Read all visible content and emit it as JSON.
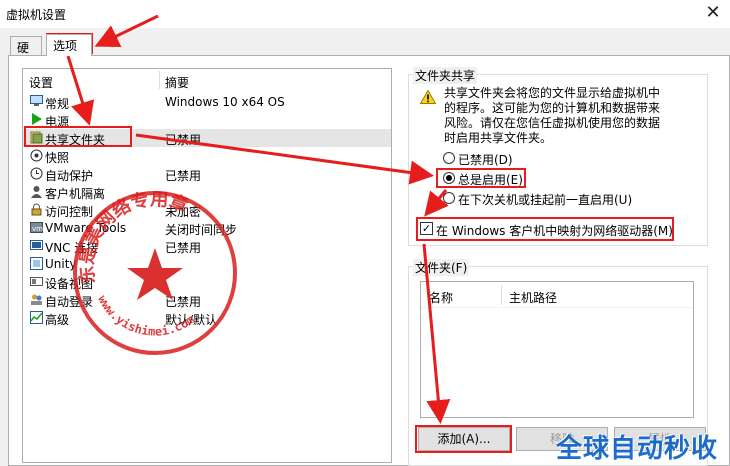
{
  "window": {
    "title": "虚拟机设置"
  },
  "tabs": [
    {
      "label": "硬件"
    },
    {
      "label": "选项"
    }
  ],
  "settings_list": {
    "headers": {
      "setting": "设置",
      "summary": "摘要"
    },
    "rows": [
      {
        "name": "常规",
        "summary": "Windows 10 x64 OS",
        "icon": "monitor-icon"
      },
      {
        "name": "电源",
        "summary": "",
        "icon": "play-icon"
      },
      {
        "name": "共享文件夹",
        "summary": "已禁用",
        "icon": "shared-folder-icon"
      },
      {
        "name": "快照",
        "summary": "",
        "icon": "snapshot-icon"
      },
      {
        "name": "自动保护",
        "summary": "已禁用",
        "icon": "clock-icon"
      },
      {
        "name": "客户机隔离",
        "summary": "",
        "icon": "user-icon"
      },
      {
        "name": "访问控制",
        "summary": "未加密",
        "icon": "lock-icon"
      },
      {
        "name": "VMware Tools",
        "summary": "关闭时间同步",
        "icon": "vm-icon"
      },
      {
        "name": "VNC 连接",
        "summary": "已禁用",
        "icon": "vnc-icon"
      },
      {
        "name": "Unity",
        "summary": "",
        "icon": "unity-icon"
      },
      {
        "name": "设备视图",
        "summary": "",
        "icon": "device-view-icon"
      },
      {
        "name": "自动登录",
        "summary": "已禁用",
        "icon": "users-icon"
      },
      {
        "name": "高级",
        "summary": "默认/默认",
        "icon": "chart-icon"
      }
    ]
  },
  "shared_folders": {
    "group_label": "文件夹共享",
    "warning": "共享文件夹会将您的文件显示给虚拟机中的程序。这可能为您的计算机和数据带来风险。请仅在您信任虚拟机使用您的数据时启用共享文件夹。",
    "options": [
      {
        "label": "已禁用(D)",
        "selected": false
      },
      {
        "label": "总是启用(E)",
        "selected": true
      },
      {
        "label": "在下次关机或挂起前一直启用(U)",
        "selected": false
      }
    ],
    "map_drive": {
      "label": "在 Windows 客户机中映射为网络驱动器(M)",
      "checked": true
    }
  },
  "folders": {
    "group_label": "文件夹(F)",
    "columns": {
      "name": "名称",
      "host_path": "主机路径"
    },
    "buttons": {
      "add": "添加(A)...",
      "remove": "移除",
      "properties": "属性"
    }
  },
  "stamp": {
    "text": "东是美网络专用章",
    "url": "www.yishimei.com"
  },
  "watermark": "全球自动秒收",
  "colors": {
    "highlight": "#e51d1d",
    "stamp": "#d81e1e",
    "watermark": "#0c62c7"
  }
}
